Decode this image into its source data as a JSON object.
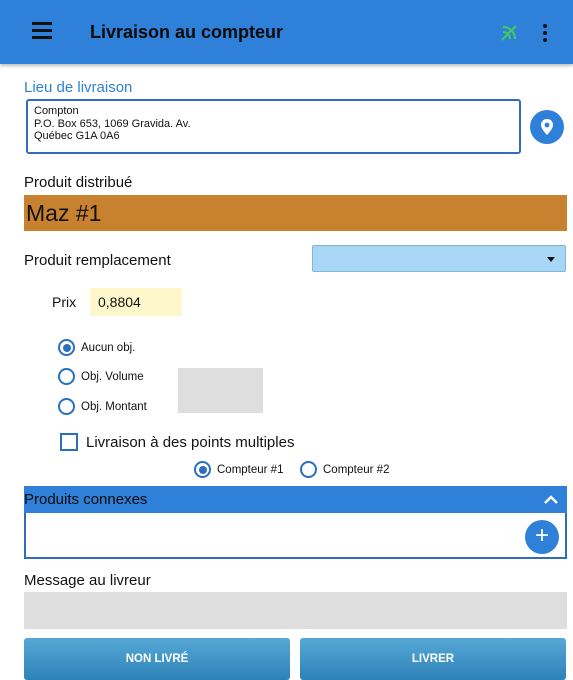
{
  "header": {
    "title": "Livraison au compteur",
    "menu_icon": "hamburger-menu-icon",
    "status_icon": "signal-icon",
    "overflow_icon": "more-vert-icon",
    "accent": "#2f80d8"
  },
  "delivery_location": {
    "label": "Lieu de livraison",
    "lines": [
      "Compton",
      "P.O. Box 653, 1069 Gravida. Av.",
      "Québec G1A 0A6"
    ],
    "location_icon": "map-marker-icon"
  },
  "distributed_product": {
    "label": "Produit distribué",
    "value": "Maz #1",
    "color": "#c8822f"
  },
  "replacement_product": {
    "label": "Produit remplacement",
    "selected": ""
  },
  "price": {
    "label": "Prix",
    "value": "0,8804"
  },
  "objective_options": [
    {
      "label": "Aucun obj.",
      "selected": true
    },
    {
      "label": "Obj. Volume",
      "selected": false
    },
    {
      "label": "Obj. Montant",
      "selected": false
    }
  ],
  "multi_point": {
    "label": "Livraison à des points multiples",
    "checked": false
  },
  "meters": [
    {
      "label": "Compteur #1",
      "selected": true
    },
    {
      "label": "Compteur #2",
      "selected": false
    }
  ],
  "related_products": {
    "label": "Produits connexes",
    "expanded": true,
    "add_icon": "plus-icon"
  },
  "driver_message": {
    "label": "Message au livreur",
    "value": ""
  },
  "actions": {
    "not_delivered": "NON LIVRÉ",
    "deliver": "LIVRER"
  }
}
